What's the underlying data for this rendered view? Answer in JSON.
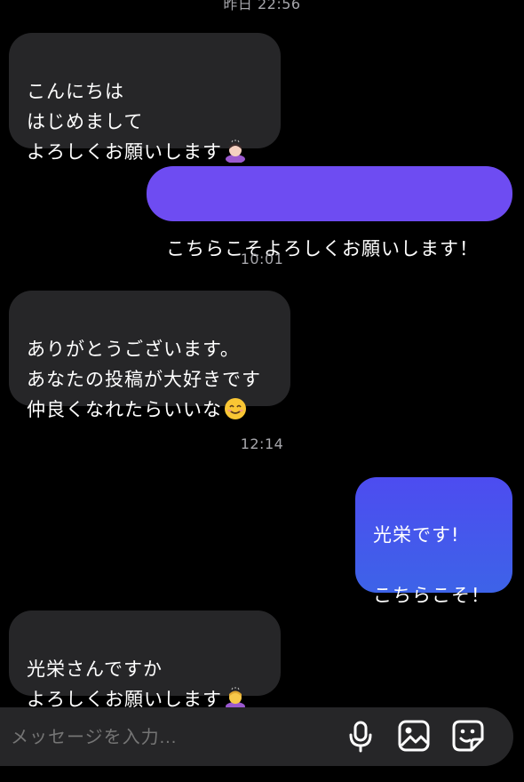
{
  "timestamps": {
    "top": "昨日 22:56",
    "first": "10:01",
    "second": "12:14"
  },
  "messages": [
    {
      "side": "incoming",
      "text": "こんにちは\nはじめまして\nよろしくお願いします",
      "emoji": "woman-bowing-emoji"
    },
    {
      "side": "outgoing",
      "text": "こちらこそよろしくお願いします！"
    },
    {
      "side": "incoming",
      "text": "ありがとうございます。\nあなたの投稿が大好きです\n仲良くなれたらいいな",
      "emoji": "smiling-face-emoji"
    },
    {
      "side": "outgoing",
      "text": "光栄です!\n\nこちらこそ！"
    },
    {
      "side": "incoming",
      "text": "光栄さんですか\nよろしくお願いします",
      "emoji": "woman-bowing-emoji"
    }
  ],
  "composer": {
    "placeholder": "メッセージを入力...",
    "icons": [
      "microphone-icon",
      "image-icon",
      "sticker-icon"
    ]
  },
  "colors": {
    "background": "#000000",
    "incoming_bubble": "#262628",
    "outgoing_bubble_purple": "#6e4cf2",
    "outgoing_bubble_blue": "#4356ee",
    "timestamp": "#a6a6ab"
  }
}
